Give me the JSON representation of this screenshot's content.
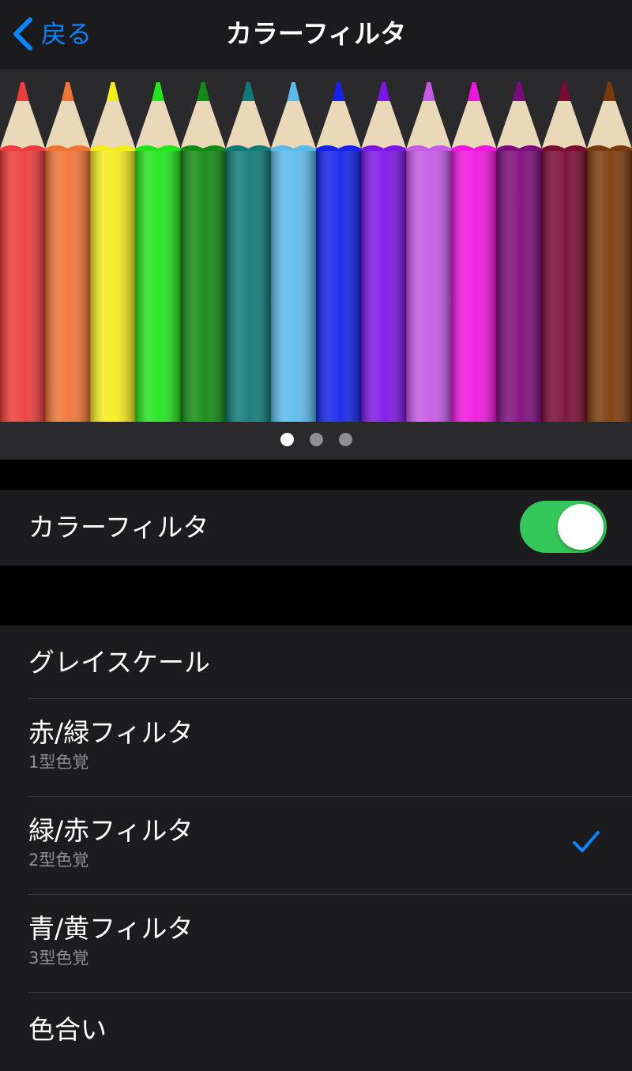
{
  "nav": {
    "back_label": "戻る",
    "title": "カラーフィルタ"
  },
  "preview": {
    "pencil_colors": [
      "#ee3b3b",
      "#f07336",
      "#f5ec1c",
      "#22e51c",
      "#138a16",
      "#107a78",
      "#5bbbe9",
      "#1523e8",
      "#7b16e6",
      "#c45ae6",
      "#f016e0",
      "#7c0c7c",
      "#7a0b33",
      "#7a3b0c"
    ],
    "page_count": 3,
    "active_page": 1
  },
  "toggle": {
    "label": "カラーフィルタ",
    "on": true,
    "on_color": "#34c759"
  },
  "options": [
    {
      "title": "グレイスケール",
      "subtitle": "",
      "checked": false
    },
    {
      "title": "赤/緑フィルタ",
      "subtitle": "1型色覚",
      "checked": false
    },
    {
      "title": "緑/赤フィルタ",
      "subtitle": "2型色覚",
      "checked": true
    },
    {
      "title": "青/黄フィルタ",
      "subtitle": "3型色覚",
      "checked": false
    },
    {
      "title": "色合い",
      "subtitle": "",
      "checked": false
    }
  ],
  "colors": {
    "accent": "#0a84ff",
    "background": "#000000",
    "cell": "#1c1c1e"
  }
}
